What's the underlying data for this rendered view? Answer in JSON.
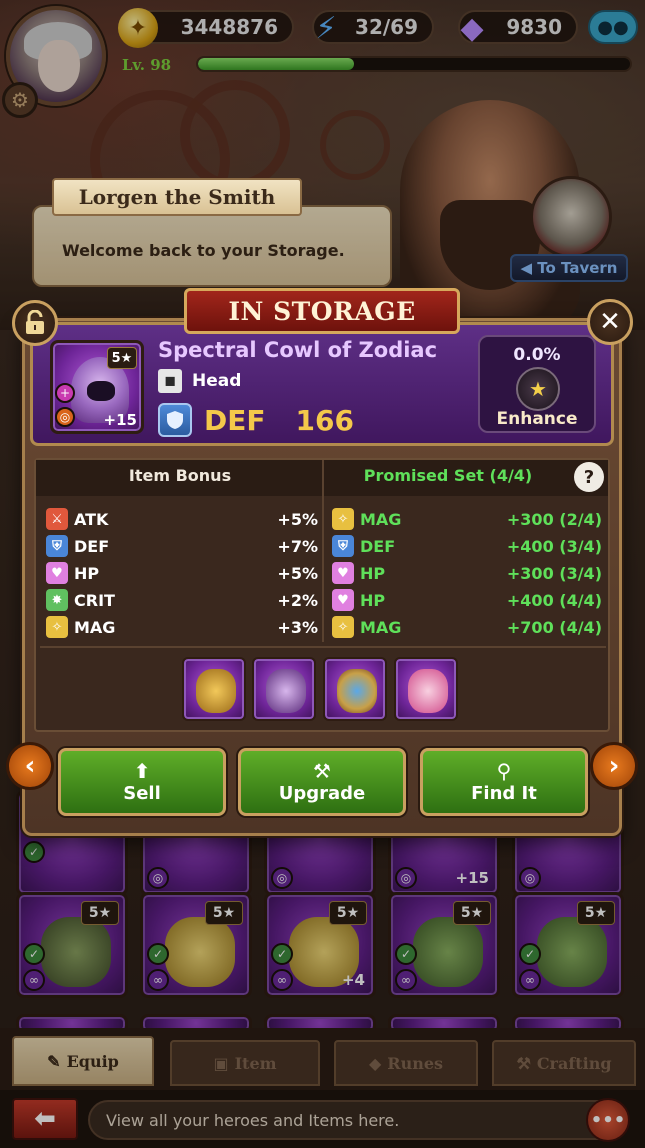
{
  "top_bar": {
    "gold": "3448876",
    "energy": "32/69",
    "gems": "9830",
    "level": "Lv. 98",
    "xp_fraction": 0.36
  },
  "npc": {
    "name": "Lorgen the Smith",
    "message": "Welcome back to your Storage.",
    "tavern_button": "◀ To Tavern"
  },
  "modal": {
    "title": "IN STORAGE",
    "item": {
      "name": "Spectral Cowl of Zodiac",
      "stars": "5★",
      "plus": "+15",
      "slot": "Head",
      "main_stat_label": "DEF",
      "main_stat_value": "166"
    },
    "enhance": {
      "percent": "0.0%",
      "label": "Enhance"
    },
    "bonus_header": "Item Bonus",
    "set_header": "Promised Set (4/4)",
    "help": "?",
    "item_bonus": [
      {
        "stat": "ATK",
        "value": "+5%",
        "icon": "sword-icon"
      },
      {
        "stat": "DEF",
        "value": "+7%",
        "icon": "shield-icon"
      },
      {
        "stat": "HP",
        "value": "+5%",
        "icon": "heart-icon"
      },
      {
        "stat": "CRIT",
        "value": "+2%",
        "icon": "crit-icon"
      },
      {
        "stat": "MAG",
        "value": "+3%",
        "icon": "magic-icon"
      }
    ],
    "set_bonus": [
      {
        "stat": "MAG",
        "value": "+300 (2/4)",
        "icon": "magic-icon"
      },
      {
        "stat": "DEF",
        "value": "+400 (3/4)",
        "icon": "shield-icon"
      },
      {
        "stat": "HP",
        "value": "+300 (3/4)",
        "icon": "heart-icon"
      },
      {
        "stat": "HP",
        "value": "+400 (4/4)",
        "icon": "heart-icon"
      },
      {
        "stat": "MAG",
        "value": "+700 (4/4)",
        "icon": "magic-icon"
      }
    ],
    "set_pieces": [
      "scepter",
      "cowl",
      "ring",
      "wings"
    ],
    "buttons": {
      "sell": "Sell",
      "upgrade": "Upgrade",
      "find": "Find It"
    }
  },
  "grid": {
    "stars": "5★",
    "plus_a": "+15",
    "plus_b": "+4"
  },
  "tabs": [
    "Equip",
    "Item",
    "Runes",
    "Crafting"
  ],
  "hint": "View all your heroes and Items here.",
  "colors": {
    "accent_gold": "#f4c84a",
    "set_green": "#5fe05a",
    "item_purple": "#e7c8ff",
    "button_green": "#4a9a1e"
  }
}
